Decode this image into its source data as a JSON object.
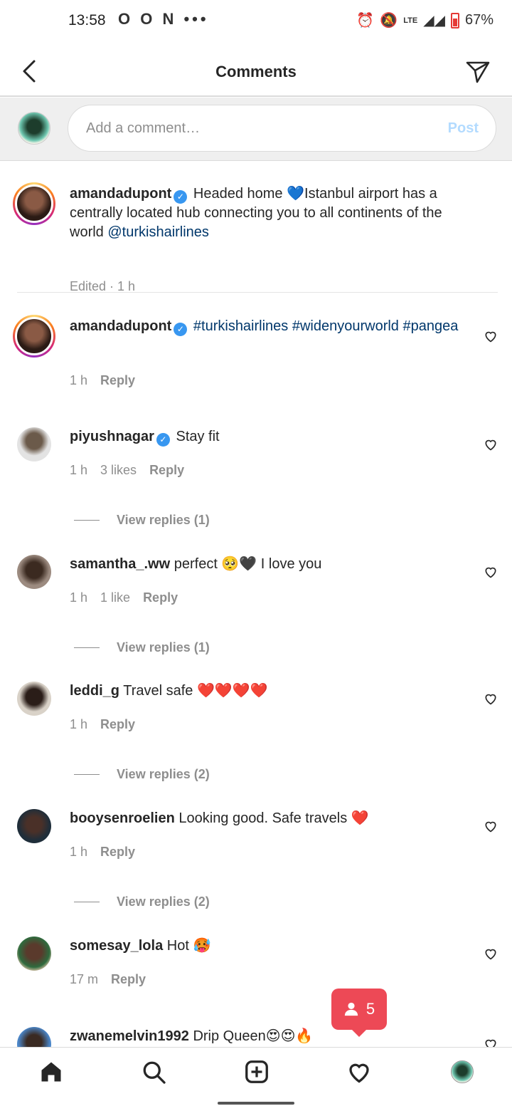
{
  "status_bar": {
    "time": "13:58",
    "left_icons": "O O N •••",
    "lte": "LTE",
    "battery_percent": "67%"
  },
  "header": {
    "title": "Comments"
  },
  "input": {
    "placeholder": "Add a comment…",
    "post_label": "Post"
  },
  "caption": {
    "username": "amandadupont",
    "text_before": "Headed home 💙Istanbul airport has a centrally located hub connecting you to all continents of the world ",
    "mention": "@turkishairlines",
    "meta": "Edited · 1 h"
  },
  "comments": [
    {
      "username": "amandadupont",
      "verified": true,
      "text": "",
      "hashtags": "#turkishairlines #widenyourworld #pangea",
      "time": "1 h",
      "likes": "",
      "reply": "Reply",
      "view_replies": ""
    },
    {
      "username": "piyushnagar",
      "verified": true,
      "text": "Stay fit",
      "time": "1 h",
      "likes": "3 likes",
      "reply": "Reply",
      "view_replies": "View replies (1)"
    },
    {
      "username": "samantha_.ww",
      "verified": false,
      "text": "perfect 🥺🖤 I love you",
      "time": "1 h",
      "likes": "1 like",
      "reply": "Reply",
      "view_replies": "View replies (1)"
    },
    {
      "username": "leddi_g",
      "verified": false,
      "text": "Travel safe ❤️❤️❤️❤️",
      "time": "1 h",
      "likes": "",
      "reply": "Reply",
      "view_replies": "View replies (2)"
    },
    {
      "username": "booysenroelien",
      "verified": false,
      "text": "Looking good. Safe travels ❤️",
      "time": "1 h",
      "likes": "",
      "reply": "Reply",
      "view_replies": "View replies (2)"
    },
    {
      "username": "somesay_lola",
      "verified": false,
      "text": "Hot 🥵",
      "time": "17 m",
      "likes": "",
      "reply": "Reply",
      "view_replies": ""
    },
    {
      "username": "zwanemelvin1992",
      "verified": false,
      "text": "Drip Queen😍😍🔥",
      "time": "",
      "likes": "",
      "reply": "",
      "view_replies": ""
    }
  ],
  "notification": {
    "count": "5"
  },
  "icons": {
    "back": "back-arrow-icon",
    "send": "paper-plane-icon",
    "heart": "heart-outline-icon",
    "home": "home-icon",
    "search": "search-icon",
    "create": "plus-square-icon",
    "activity": "heart-icon",
    "profile": "profile-avatar"
  },
  "colors": {
    "link": "#00376b",
    "verified": "#3897f0",
    "notification": "#ed4956",
    "post_disabled": "#b3dbff"
  }
}
